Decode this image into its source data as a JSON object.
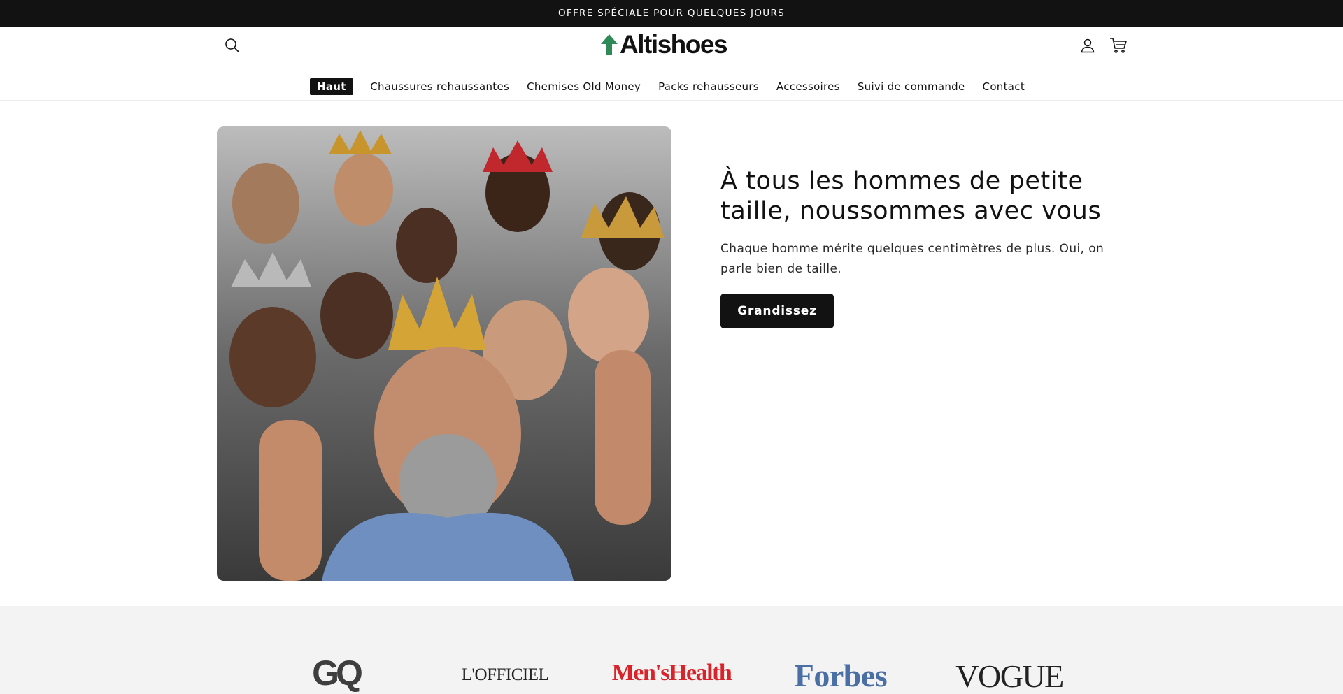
{
  "announcement": {
    "text": "OFFRE SPÉCIALE POUR QUELQUES JOURS"
  },
  "header": {
    "logo_text": "Altishoes",
    "icons": {
      "search": "search-icon",
      "account": "account-icon",
      "cart": "cart-icon",
      "logo": "up-arrow-icon"
    },
    "brand_color": "#2e8b57"
  },
  "nav": {
    "items": [
      {
        "label": "Haut",
        "active": true
      },
      {
        "label": "Chaussures rehaussantes",
        "active": false
      },
      {
        "label": "Chemises Old Money",
        "active": false
      },
      {
        "label": "Packs rehausseurs",
        "active": false
      },
      {
        "label": "Accessoires",
        "active": false
      },
      {
        "label": "Suivi de commande",
        "active": false
      },
      {
        "label": "Contact",
        "active": false
      }
    ]
  },
  "hero": {
    "title": "À tous les hommes de petite taille, noussommes avec vous",
    "subtitle": "Chaque homme mérite quelques centimètres de plus. Oui, on parle bien de taille.",
    "button_label": "Grandissez"
  },
  "press": {
    "logos": [
      "GQ",
      "L'OFFICIEL",
      "Men'sHealth",
      "Forbes",
      "VOGUE"
    ]
  }
}
